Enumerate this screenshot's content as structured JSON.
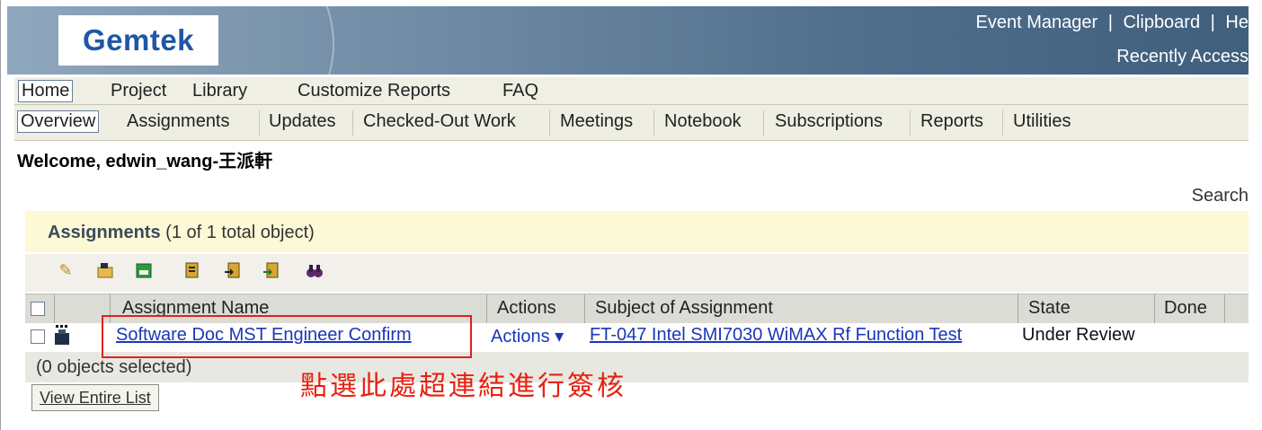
{
  "header": {
    "logo_text": "Gemtek",
    "top_links": [
      "Event Manager",
      "|",
      "Clipboard",
      "|",
      "He"
    ],
    "recently_accessed": "Recently Access"
  },
  "main_menu": [
    "Home",
    "Project",
    "Library",
    "Customize Reports",
    "FAQ"
  ],
  "sub_menu": [
    "Overview",
    "Assignments",
    "Updates",
    "Checked-Out Work",
    "Meetings",
    "Notebook",
    "Subscriptions",
    "Reports",
    "Utilities"
  ],
  "welcome": "Welcome, edwin_wang-王派軒",
  "search_label": "Search",
  "panel": {
    "title": "Assignments",
    "count": "(1 of 1 total object)"
  },
  "toolbar_icons": [
    "pencil-icon",
    "open-folder-icon",
    "save-icon",
    "report-icon",
    "export-icon",
    "import-icon",
    "binoculars-icon"
  ],
  "table": {
    "headers": [
      "Assignment Name",
      "Actions",
      "Subject of Assignment",
      "State",
      "Done"
    ],
    "row": {
      "name": "Software Doc MST Engineer Confirm",
      "actions": "Actions ▾",
      "subject": "FT-047 Intel SMI7030 WiMAX Rf Function Test",
      "state": "Under Review",
      "done": ""
    },
    "selected_count": "(0 objects selected)",
    "view_list": "View Entire List"
  },
  "annotation": "點選此處超連結進行簽核",
  "colors": {
    "link": "#1a37b8",
    "annotation": "#e8200f",
    "panel_header": "#fcf9d6",
    "header_bar": "#4f6e8b"
  }
}
